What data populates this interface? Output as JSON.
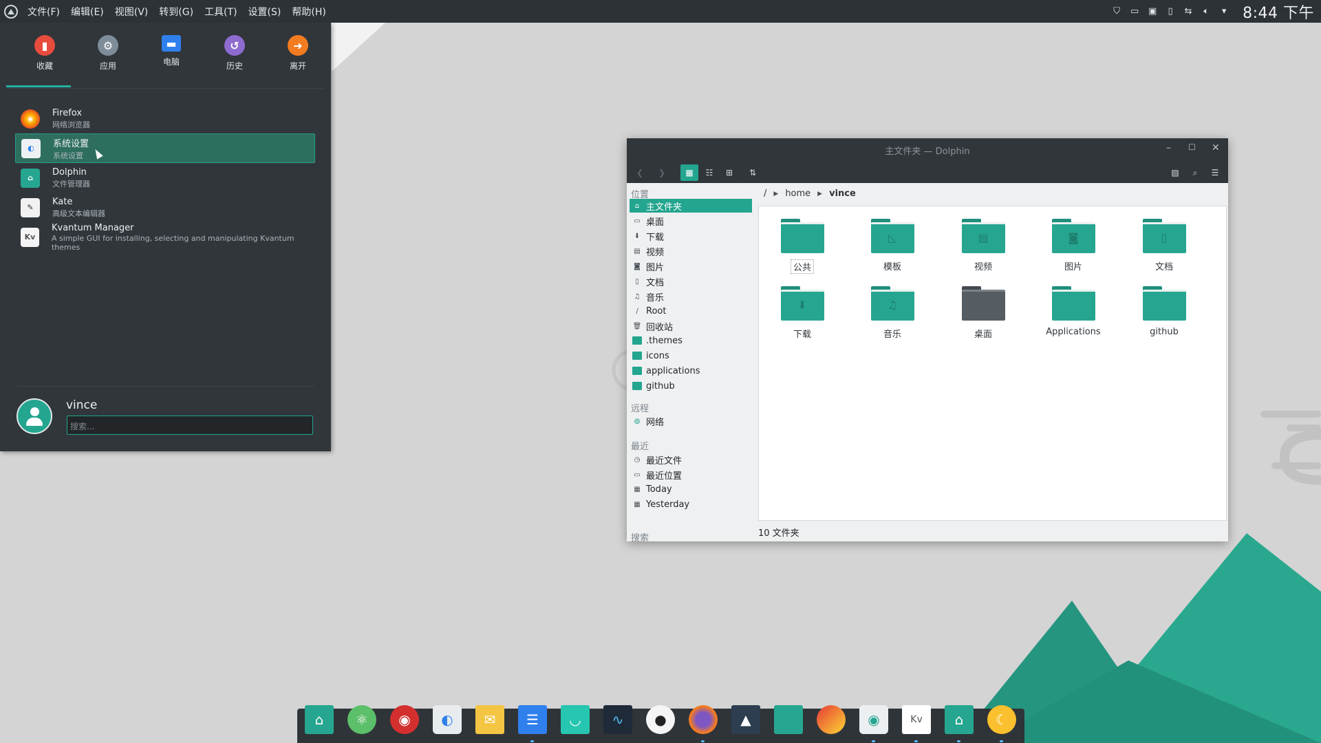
{
  "top_panel": {
    "menu": [
      "文件(F)",
      "编辑(E)",
      "视图(V)",
      "转到(G)",
      "工具(T)",
      "设置(S)",
      "帮助(H)"
    ],
    "tray_icons": [
      "shield-icon",
      "clipboard-icon",
      "screenshot-icon",
      "battery-icon",
      "network-icon",
      "volume-icon",
      "chevron-down-icon"
    ],
    "clock": "8:44 下午"
  },
  "start_menu": {
    "categories": [
      {
        "label": "收藏",
        "icon": "bookmark-icon",
        "color": "#e74c3c"
      },
      {
        "label": "应用",
        "icon": "gear-icon",
        "color": "#7f8c9a"
      },
      {
        "label": "电脑",
        "icon": "monitor-icon",
        "color": "#2f80ed"
      },
      {
        "label": "历史",
        "icon": "history-icon",
        "color": "#8e6bcf"
      },
      {
        "label": "离开",
        "icon": "exit-icon",
        "color": "#f47c20"
      }
    ],
    "apps": [
      {
        "name": "Firefox",
        "desc": "网络浏览器",
        "icon": "firefox-icon"
      },
      {
        "name": "系统设置",
        "desc": "系统设置",
        "icon": "settings-toggle-icon"
      },
      {
        "name": "Dolphin",
        "desc": "文件管理器",
        "icon": "folder-home-icon"
      },
      {
        "name": "Kate",
        "desc": "高级文本编辑器",
        "icon": "kate-icon"
      },
      {
        "name": "Kvantum Manager",
        "desc": "A simple GUI for installing, selecting and manipulating Kvantum themes",
        "icon": "kvantum-icon"
      }
    ],
    "username": "vince",
    "search_placeholder": "搜索..."
  },
  "dolphin": {
    "title": "主文件夹 — Dolphin",
    "places_header": "位置",
    "places": [
      {
        "label": "主文件夹",
        "icon": "home-icon"
      },
      {
        "label": "桌面",
        "icon": "desktop-icon"
      },
      {
        "label": "下载",
        "icon": "download-icon"
      },
      {
        "label": "视频",
        "icon": "video-icon"
      },
      {
        "label": "图片",
        "icon": "picture-icon"
      },
      {
        "label": "文档",
        "icon": "document-icon"
      },
      {
        "label": "音乐",
        "icon": "music-icon"
      },
      {
        "label": "Root",
        "icon": "root-icon"
      },
      {
        "label": "回收站",
        "icon": "trash-icon"
      },
      {
        "label": ".themes",
        "icon": "folder-icon"
      },
      {
        "label": "icons",
        "icon": "folder-icon"
      },
      {
        "label": "applications",
        "icon": "folder-icon"
      },
      {
        "label": "github",
        "icon": "folder-icon"
      }
    ],
    "remote_header": "远程",
    "remote": [
      {
        "label": "网络",
        "icon": "network-icon"
      }
    ],
    "recent_header": "最近",
    "recent": [
      {
        "label": "最近文件",
        "icon": "recent-files-icon"
      },
      {
        "label": "最近位置",
        "icon": "recent-locations-icon"
      },
      {
        "label": "Today",
        "icon": "calendar-icon"
      },
      {
        "label": "Yesterday",
        "icon": "calendar-icon"
      }
    ],
    "search_header": "搜索",
    "breadcrumb": {
      "root": "/",
      "home": "home",
      "current": "vince"
    },
    "files": [
      {
        "label": "公共",
        "glyph": "",
        "icon": "folder-public-icon"
      },
      {
        "label": "模板",
        "glyph": "◺",
        "icon": "folder-templates-icon"
      },
      {
        "label": "视频",
        "glyph": "▤",
        "icon": "folder-videos-icon"
      },
      {
        "label": "图片",
        "glyph": "◙",
        "icon": "folder-pictures-icon"
      },
      {
        "label": "文档",
        "glyph": "▯",
        "icon": "folder-documents-icon"
      },
      {
        "label": "下载",
        "glyph": "⬇",
        "icon": "folder-downloads-icon"
      },
      {
        "label": "音乐",
        "glyph": "♫",
        "icon": "folder-music-icon"
      },
      {
        "label": "桌面",
        "glyph": "",
        "icon": "folder-desktop-icon"
      },
      {
        "label": "Applications",
        "glyph": "",
        "icon": "folder-icon"
      },
      {
        "label": "github",
        "glyph": "",
        "icon": "folder-icon"
      }
    ],
    "status": "10 文件夹"
  },
  "dock": {
    "items": [
      {
        "icon": "home-folder-icon",
        "color": "#26a690"
      },
      {
        "icon": "atom-icon",
        "color": "#5cbf6a"
      },
      {
        "icon": "netease-music-icon",
        "color": "#d32f2f"
      },
      {
        "icon": "settings-toggle-icon",
        "color": "#e8ecef"
      },
      {
        "icon": "mail-icon",
        "color": "#f4c542"
      },
      {
        "icon": "mixer-icon",
        "color": "#2f80ed"
      },
      {
        "icon": "store-icon",
        "color": "#26c6b0"
      },
      {
        "icon": "system-monitor-icon",
        "color": "#1f2a38"
      },
      {
        "icon": "github-icon",
        "color": "#f5f5f5"
      },
      {
        "icon": "firefox-icon",
        "color": "#f57c20"
      },
      {
        "icon": "mountain-icon",
        "color": "#2c3e50"
      },
      {
        "icon": "folder-icon",
        "color": "#26a690"
      },
      {
        "icon": "color-picker-icon",
        "color": "#e53935"
      },
      {
        "icon": "toggle-icon",
        "color": "#eceff1"
      },
      {
        "icon": "kvantum-icon",
        "color": "#ffffff"
      },
      {
        "icon": "folder-home-icon",
        "color": "#26a690"
      },
      {
        "icon": "night-mode-icon",
        "color": "#fbc02d"
      }
    ]
  }
}
